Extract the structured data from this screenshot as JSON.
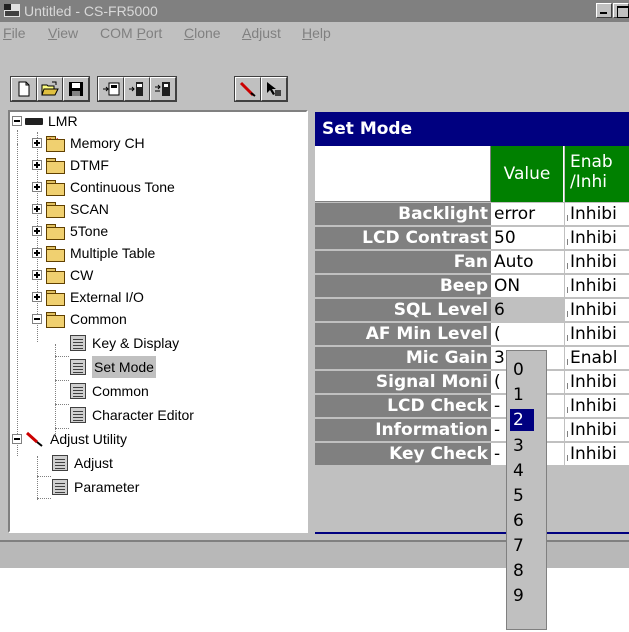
{
  "window": {
    "title": "Untitled - CS-FR5000"
  },
  "menu": [
    {
      "label": "File",
      "key": "F",
      "rest": "ile"
    },
    {
      "label": "View",
      "key": "V",
      "rest": "iew"
    },
    {
      "label": "COM Port",
      "pre": "COM ",
      "key": "P",
      "rest": "ort"
    },
    {
      "label": "Clone",
      "key": "C",
      "rest": "lone"
    },
    {
      "label": "Adjust",
      "key": "A",
      "rest": "djust"
    },
    {
      "label": "Help",
      "key": "H",
      "rest": "elp"
    }
  ],
  "toolbar": {
    "icons": [
      "new-file-icon",
      "open-folder-icon",
      "save-disk-icon",
      "read-radio-icon",
      "write-radio-icon",
      "clone-icon",
      "adjust-tool-icon",
      "help-pointer-icon"
    ]
  },
  "tree": {
    "root": "LMR",
    "items": [
      {
        "label": "Memory CH"
      },
      {
        "label": "DTMF"
      },
      {
        "label": "Continuous Tone"
      },
      {
        "label": "SCAN"
      },
      {
        "label": "5Tone"
      },
      {
        "label": "Multiple Table"
      },
      {
        "label": "CW"
      },
      {
        "label": "External I/O"
      },
      {
        "label": "Common"
      }
    ],
    "common_children": [
      {
        "label": "Key & Display"
      },
      {
        "label": "Set Mode"
      },
      {
        "label": "Common"
      },
      {
        "label": "Character Editor"
      }
    ],
    "adjust_root": "Adjust Utility",
    "adjust_children": [
      {
        "label": "Adjust"
      },
      {
        "label": "Parameter"
      }
    ]
  },
  "panel": {
    "title": "Set Mode",
    "header_value": "Value",
    "header_enable_line1": "Enab",
    "header_enable_line2": "/Inhi",
    "rows": [
      {
        "label": "Backlight",
        "value": "error",
        "enable": "Inhibi"
      },
      {
        "label": "LCD Contrast",
        "value": "50",
        "enable": "Inhibi"
      },
      {
        "label": "Fan",
        "value": "Auto",
        "enable": "Inhibi"
      },
      {
        "label": "Beep",
        "value": "ON",
        "enable": "Inhibi"
      },
      {
        "label": "SQL Level",
        "value": "6",
        "enable": "Inhibi"
      },
      {
        "label": "AF Min Level",
        "value": "(",
        "enable": "Inhibi"
      },
      {
        "label": "Mic Gain",
        "value": "3",
        "enable": "Enabl"
      },
      {
        "label": "Signal Moni",
        "value": "(",
        "enable": "Inhibi"
      },
      {
        "label": "LCD Check",
        "value": "-",
        "enable": "Inhibi"
      },
      {
        "label": "Information",
        "value": "-",
        "enable": "Inhibi"
      },
      {
        "label": "Key Check",
        "value": "-",
        "enable": "Inhibi"
      }
    ]
  },
  "dropdown": {
    "options": [
      "0",
      "1",
      "2",
      "3",
      "4",
      "5",
      "6",
      "7",
      "8",
      "9"
    ],
    "selected": "2"
  }
}
